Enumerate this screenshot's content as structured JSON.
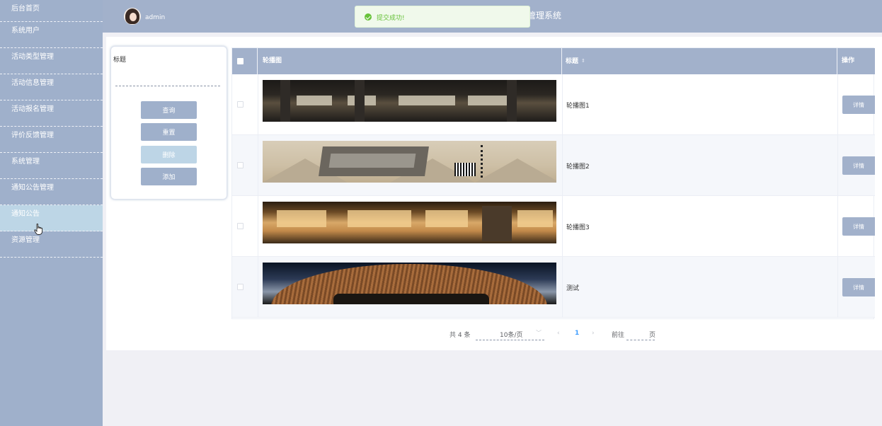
{
  "sidebar": {
    "items": [
      {
        "label": "后台首页"
      },
      {
        "label": "系统用户"
      },
      {
        "label": "活动类型管理"
      },
      {
        "label": "活动信息管理"
      },
      {
        "label": "活动报名管理"
      },
      {
        "label": "评价反馈管理"
      },
      {
        "label": "系统管理"
      },
      {
        "label": "通知公告管理"
      },
      {
        "label": "通知公告",
        "active": true
      },
      {
        "label": "资源管理"
      }
    ]
  },
  "header": {
    "username": "admin",
    "title": "管理系统"
  },
  "toast": {
    "message": "提交成功!",
    "color": "#67c23a"
  },
  "search": {
    "field_label": "标题",
    "field_value": "",
    "buttons": {
      "query": "查询",
      "reset": "重置",
      "delete": "删除",
      "add": "添加"
    }
  },
  "table": {
    "headers": {
      "image": "轮播图",
      "title": "标题",
      "operation": "操作"
    },
    "rows": [
      {
        "title": "轮播图1",
        "detail": "详情"
      },
      {
        "title": "轮播图2",
        "detail": "详情"
      },
      {
        "title": "轮播图3",
        "detail": "详情"
      },
      {
        "title": "测试",
        "detail": "详情"
      }
    ]
  },
  "pagination": {
    "total": "共 4 条",
    "page_size": "10条/页",
    "current": "1",
    "goto": "前往",
    "page_unit": "页"
  },
  "colors": {
    "sidebar_bg": "#9fb0cb",
    "header_bg": "#a2b1cb",
    "active_item": "#bdd6e6",
    "accent": "#409eff"
  }
}
